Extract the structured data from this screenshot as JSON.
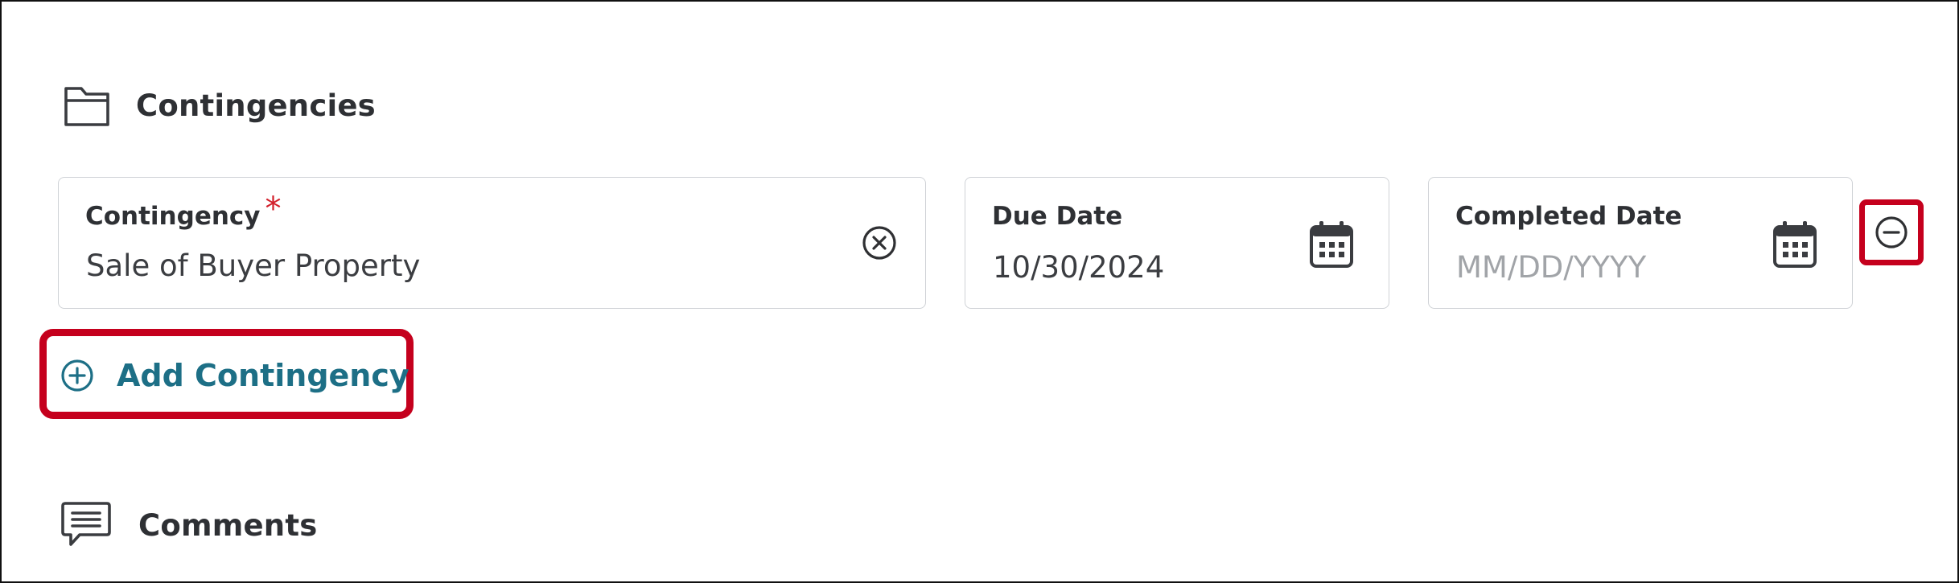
{
  "sections": {
    "contingencies": {
      "title": "Contingencies",
      "icon": "folder-icon"
    },
    "comments": {
      "title": "Comments",
      "icon": "comment-icon"
    }
  },
  "fields": {
    "contingency": {
      "label": "Contingency",
      "required_marker": "*",
      "value": "Sale of Buyer Property",
      "trailing_icon": "clear-icon"
    },
    "due_date": {
      "label": "Due Date",
      "value": "10/30/2024",
      "trailing_icon": "calendar-icon"
    },
    "completed_date": {
      "label": "Completed Date",
      "value": "",
      "placeholder": "MM/DD/YYYY",
      "trailing_icon": "calendar-icon"
    }
  },
  "actions": {
    "add_contingency_label": "Add Contingency",
    "add_icon": "plus-circle-icon",
    "remove_icon": "minus-circle-icon"
  },
  "colors": {
    "accent": "#1d6f86",
    "required": "#d3202b",
    "highlight": "#c5001d",
    "text": "#2e3034",
    "placeholder": "#a1a4a8",
    "border": "#cfd2d6"
  }
}
